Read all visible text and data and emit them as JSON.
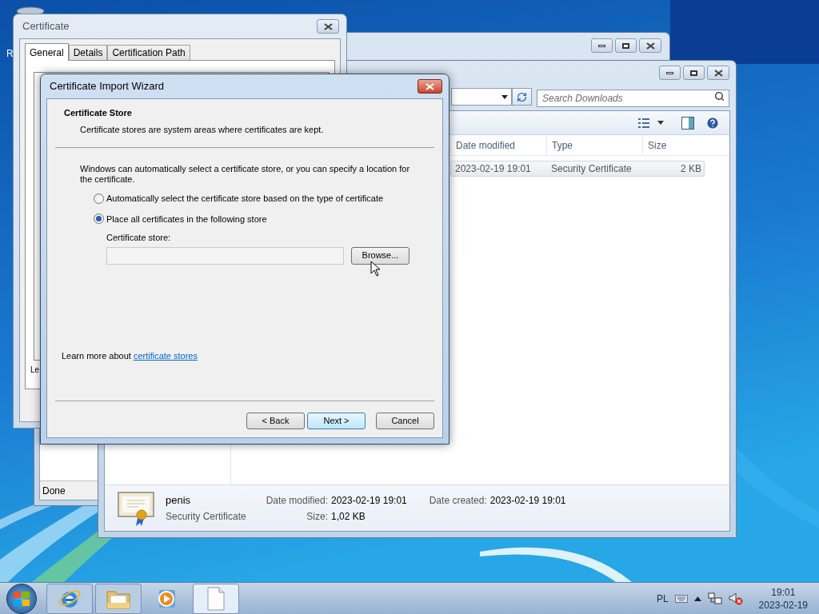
{
  "desktop": {
    "icon_label": "R"
  },
  "certificate_window": {
    "title": "Certificate",
    "tabs": [
      {
        "label": "General",
        "selected": true
      },
      {
        "label": "Details",
        "selected": false
      },
      {
        "label": "Certification Path",
        "selected": false
      }
    ],
    "partial_text": "Le"
  },
  "browser_window": {
    "status": "Done"
  },
  "explorer": {
    "search": {
      "placeholder": "Search Downloads"
    },
    "columns": [
      {
        "label": "Date modified"
      },
      {
        "label": "Type"
      },
      {
        "label": "Size"
      }
    ],
    "rows": [
      {
        "date_modified": "2023-02-19 19:01",
        "type": "Security Certificate",
        "size": "2 KB",
        "selected": true
      }
    ],
    "details": {
      "name": "penis",
      "type": "Security Certificate",
      "fields": [
        {
          "label": "Date modified:",
          "value": "2023-02-19 19:01"
        },
        {
          "label": "Size:",
          "value": "1,02 KB"
        },
        {
          "label": "Date created:",
          "value": "2023-02-19 19:01"
        }
      ]
    }
  },
  "wizard": {
    "title": "Certificate Import Wizard",
    "heading": "Certificate Store",
    "subheading": "Certificate stores are system areas where certificates are kept.",
    "intro": "Windows can automatically select a certificate store, or you can specify a location for the certificate.",
    "options": [
      {
        "label": "Automatically select the certificate store based on the type of certificate",
        "selected": false
      },
      {
        "label": "Place all certificates in the following store",
        "selected": true
      }
    ],
    "store_label": "Certificate store:",
    "browse": "Browse...",
    "learn_more": {
      "text": "Learn more about",
      "link": "certificate stores"
    },
    "buttons": [
      {
        "label": "< Back",
        "default": false
      },
      {
        "label": "Next >",
        "default": true
      },
      {
        "label": "Cancel",
        "default": false
      }
    ]
  },
  "taskbar": {
    "items": [
      {
        "kind": "browser",
        "running": true,
        "active": false
      },
      {
        "kind": "folder",
        "running": true,
        "active": false
      },
      {
        "kind": "media",
        "running": false,
        "active": false
      },
      {
        "kind": "document",
        "running": true,
        "active": true
      }
    ],
    "language": "PL",
    "time": "19:01",
    "date": "2023-02-19"
  }
}
